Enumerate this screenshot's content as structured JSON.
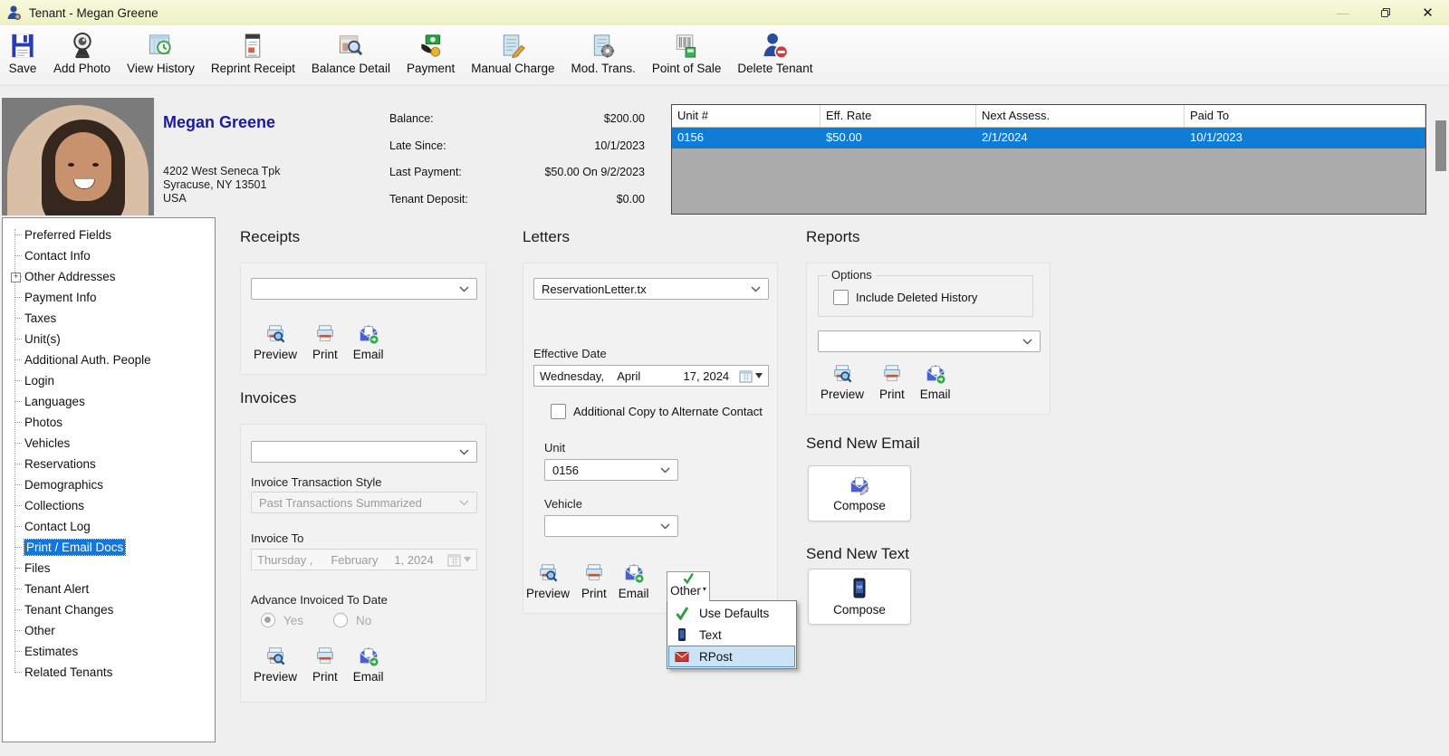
{
  "window": {
    "title": "Tenant - Megan Greene"
  },
  "toolbar": {
    "items": [
      {
        "label": "Save",
        "icon": "floppy-disk"
      },
      {
        "label": "Add Photo",
        "icon": "webcam"
      },
      {
        "label": "View History",
        "icon": "window-clock"
      },
      {
        "label": "Reprint Receipt",
        "icon": "receipt"
      },
      {
        "label": "Balance Detail",
        "icon": "window-magnifier"
      },
      {
        "label": "Payment",
        "icon": "hand-money"
      },
      {
        "label": "Manual Charge",
        "icon": "document-pencil"
      },
      {
        "label": "Mod. Trans.",
        "icon": "document-gear"
      },
      {
        "label": "Point of Sale",
        "icon": "barcode"
      },
      {
        "label": "Delete Tenant",
        "icon": "person-minus"
      }
    ]
  },
  "tenant": {
    "name": "Megan Greene",
    "address1": "4202 West Seneca Tpk",
    "address2": "Syracuse, NY 13501",
    "address3": "USA"
  },
  "balance": {
    "rows": [
      {
        "label": "Balance:",
        "value": "$200.00"
      },
      {
        "label": "Late Since:",
        "value": "10/1/2023"
      },
      {
        "label": "Last Payment:",
        "value": "$50.00 On 9/2/2023"
      },
      {
        "label": "Tenant Deposit:",
        "value": "$0.00"
      }
    ]
  },
  "units_table": {
    "headers": [
      "Unit #",
      "Eff. Rate",
      "Next Assess.",
      "Paid To"
    ],
    "row": [
      "0156",
      "$50.00",
      "2/1/2024",
      "10/1/2023"
    ]
  },
  "sidebar": {
    "items": [
      "Preferred Fields",
      "Contact Info",
      "Other Addresses",
      "Payment Info",
      "Taxes",
      "Unit(s)",
      "Additional Auth. People",
      "Login",
      "Languages",
      "Photos",
      "Vehicles",
      "Reservations",
      "Demographics",
      "Collections",
      "Contact Log",
      "Print / Email Docs",
      "Files",
      "Tenant Alert",
      "Tenant Changes",
      "Other",
      "Estimates",
      "Related Tenants"
    ],
    "selected": "Print / Email Docs",
    "expandable_item": "Other Addresses"
  },
  "actions": {
    "preview": "Preview",
    "print": "Print",
    "email": "Email",
    "other": "Other",
    "compose": "Compose"
  },
  "receipts": {
    "title": "Receipts",
    "dropdown_value": ""
  },
  "invoices": {
    "title": "Invoices",
    "dropdown_value": "",
    "style_label": "Invoice Transaction Style",
    "style_value": "Past Transactions Summarized",
    "invoice_to_label": "Invoice To",
    "date_weekday": "Thursday ,",
    "date_month": "February",
    "date_day": "1, 2024",
    "advance_label": "Advance Invoiced To Date",
    "yes_label": "Yes",
    "no_label": "No",
    "advance_selected": "Yes"
  },
  "letters": {
    "title": "Letters",
    "dropdown_value": "ReservationLetter.tx",
    "effective_date_label": "Effective Date",
    "date_weekday": "Wednesday,",
    "date_month": "April",
    "date_day": "17, 2024",
    "alt_copy_label": "Additional Copy to Alternate Contact",
    "unit_label": "Unit",
    "unit_value": "0156",
    "vehicle_label": "Vehicle",
    "vehicle_value": ""
  },
  "other_menu": {
    "items": [
      {
        "label": "Use Defaults",
        "icon": "green-check"
      },
      {
        "label": "Text",
        "icon": "phone"
      },
      {
        "label": "RPost",
        "icon": "red-envelope"
      }
    ],
    "selected": "RPost"
  },
  "reports": {
    "title": "Reports",
    "options_label": "Options",
    "include_deleted_label": "Include Deleted History",
    "dropdown_value": ""
  },
  "send_email": {
    "title": "Send New Email"
  },
  "send_text": {
    "title": "Send New Text"
  },
  "colors": {
    "titlebar_yellow": "#f6f7d4",
    "selection_blue": "#0f7cd6",
    "table_fill_gray": "#ababab",
    "tenant_name_navy": "#1b1b9e",
    "menu_highlight": "#cbe3f7"
  }
}
